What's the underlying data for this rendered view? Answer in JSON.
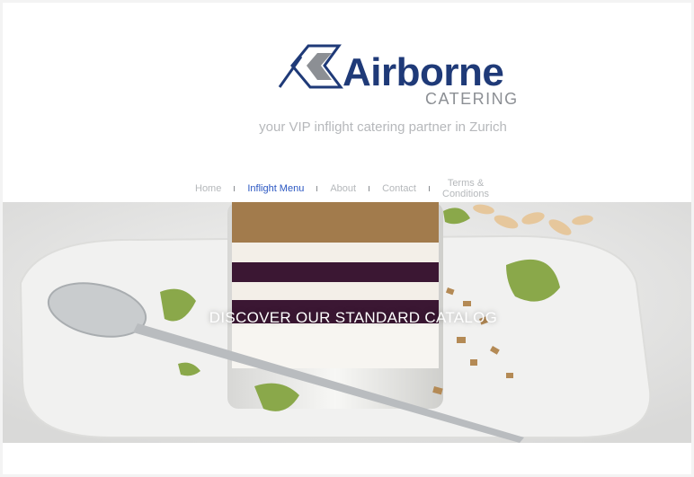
{
  "brand": {
    "name": "Airborne",
    "sub": "CATERING",
    "tagline": "your VIP inflight catering partner in Zurich",
    "colors": {
      "primary": "#1f3a78",
      "muted": "#8c8f94",
      "accent": "#2a56c2"
    }
  },
  "nav": {
    "items": [
      {
        "label": "Home"
      },
      {
        "label": "Inflight Menu",
        "active": true
      },
      {
        "label": "About"
      },
      {
        "label": "Contact"
      },
      {
        "label_line1": "Terms &",
        "label_line2": "Conditions"
      }
    ]
  },
  "hero": {
    "cta": "DISCOVER OUR STANDARD CATALOG",
    "image": "dessert-parfait-photo"
  }
}
